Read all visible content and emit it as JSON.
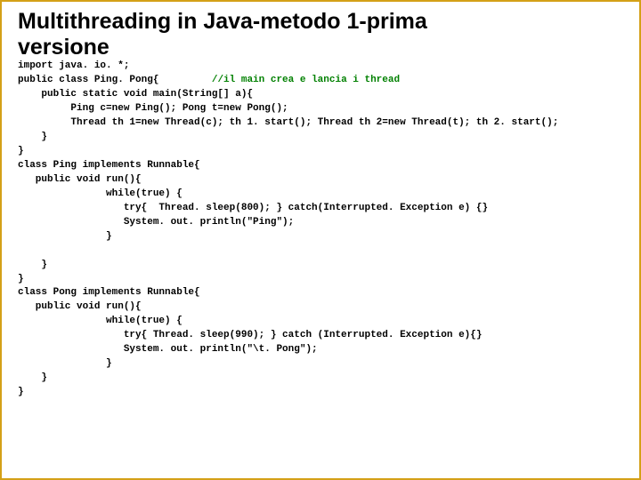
{
  "title_line1": "Multithreading in Java-metodo 1-prima",
  "title_line2": "versione",
  "code": {
    "l01": "import java. io. *;",
    "l02a": "public class Ping. Pong{         ",
    "l02b": "//il main crea e lancia i thread",
    "l03": "    public static void main(String[] a){",
    "l04": "         Ping c=new Ping(); Pong t=new Pong();",
    "l05": "         Thread th 1=new Thread(c); th 1. start(); Thread th 2=new Thread(t); th 2. start();",
    "l06": "    }",
    "l07": "}",
    "l08": "class Ping implements Runnable{",
    "l09": "   public void run(){",
    "l10": "               while(true) {",
    "l11": "                  try{  Thread. sleep(800); } catch(Interrupted. Exception e) {}",
    "l12": "                  System. out. println(\"Ping\");",
    "l13": "               }",
    "l14": "",
    "l15": "    }",
    "l16": "}",
    "l17": "class Pong implements Runnable{",
    "l18": "   public void run(){",
    "l19": "               while(true) {",
    "l20": "                  try{ Thread. sleep(990); } catch (Interrupted. Exception e){}",
    "l21": "                  System. out. println(\"\\t. Pong\");",
    "l22": "               }",
    "l23": "    }",
    "l24": "}"
  }
}
